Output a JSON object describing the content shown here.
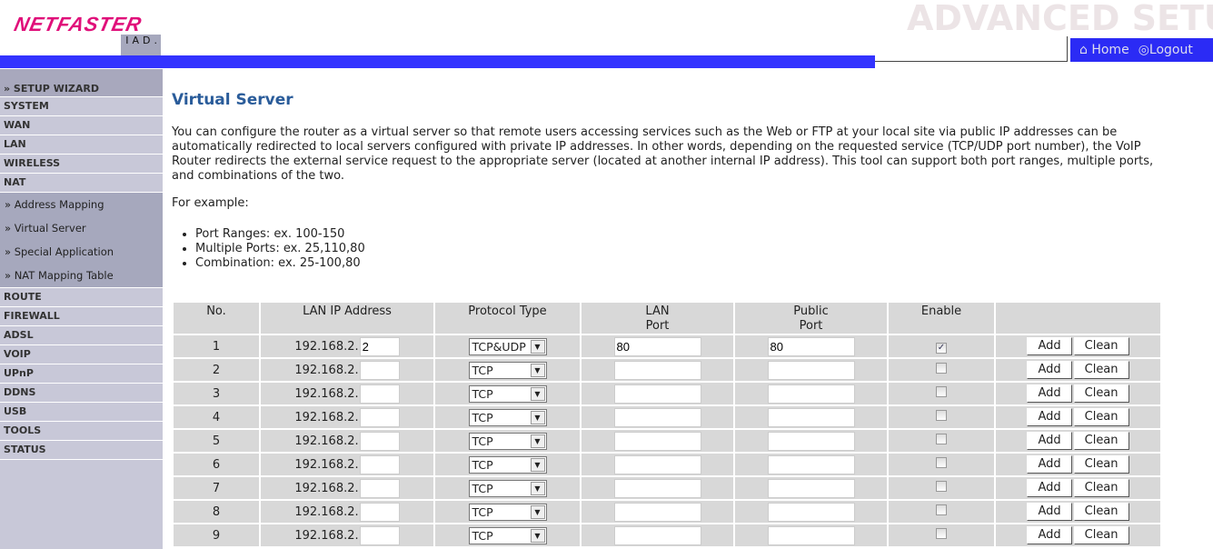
{
  "logo": {
    "main": "NETFASTER",
    "sub": "IAD."
  },
  "banner": "ADVANCED SETU",
  "tabs": {
    "home": "Home",
    "logout": "Logout"
  },
  "sidebar": {
    "wizard": "» SETUP WIZARD",
    "items_before": [
      "SYSTEM",
      "WAN",
      "LAN",
      "WIRELESS",
      "NAT"
    ],
    "nat_sub": [
      "» Address Mapping",
      "» Virtual Server",
      "» Special Application",
      "» NAT Mapping Table"
    ],
    "items_after": [
      "ROUTE",
      "FIREWALL",
      "ADSL",
      "VOIP",
      "UPnP",
      "DDNS",
      "USB",
      "TOOLS",
      "STATUS"
    ]
  },
  "content": {
    "title": "Virtual Server",
    "intro": "You can configure the router as a virtual server so that remote users accessing services such as the Web or FTP at your local site via public IP addresses can be automatically redirected to local servers configured with private IP addresses. In other words, depending on the requested service (TCP/UDP port number), the VoIP Router redirects the external service request to the appropriate server (located at another internal IP address). This tool can support both port ranges, multiple ports, and combinations of the two.",
    "example_label": "For example:",
    "examples": [
      "Port Ranges: ex. 100-150",
      "Multiple Ports: ex. 25,110,80",
      "Combination: ex. 25-100,80"
    ]
  },
  "table": {
    "headers": [
      "No.",
      "LAN IP Address",
      "Protocol Type",
      "LAN\nPort",
      "Public\nPort",
      "Enable",
      ""
    ],
    "ip_prefix": "192.168.2.",
    "add_label": "Add",
    "clean_label": "Clean",
    "rows": [
      {
        "no": "1",
        "ip": "2",
        "protocol": "TCP&UDP",
        "lan_port": "80",
        "public_port": "80",
        "enabled": true
      },
      {
        "no": "2",
        "ip": "",
        "protocol": "TCP",
        "lan_port": "",
        "public_port": "",
        "enabled": false
      },
      {
        "no": "3",
        "ip": "",
        "protocol": "TCP",
        "lan_port": "",
        "public_port": "",
        "enabled": false
      },
      {
        "no": "4",
        "ip": "",
        "protocol": "TCP",
        "lan_port": "",
        "public_port": "",
        "enabled": false
      },
      {
        "no": "5",
        "ip": "",
        "protocol": "TCP",
        "lan_port": "",
        "public_port": "",
        "enabled": false
      },
      {
        "no": "6",
        "ip": "",
        "protocol": "TCP",
        "lan_port": "",
        "public_port": "",
        "enabled": false
      },
      {
        "no": "7",
        "ip": "",
        "protocol": "TCP",
        "lan_port": "",
        "public_port": "",
        "enabled": false
      },
      {
        "no": "8",
        "ip": "",
        "protocol": "TCP",
        "lan_port": "",
        "public_port": "",
        "enabled": false
      },
      {
        "no": "9",
        "ip": "",
        "protocol": "TCP",
        "lan_port": "",
        "public_port": "",
        "enabled": false
      }
    ]
  },
  "colors": {
    "accent": "#3333ff",
    "title": "#2a5c9a",
    "logo": "#e0107a",
    "sidebar": "#c8c8d8"
  }
}
